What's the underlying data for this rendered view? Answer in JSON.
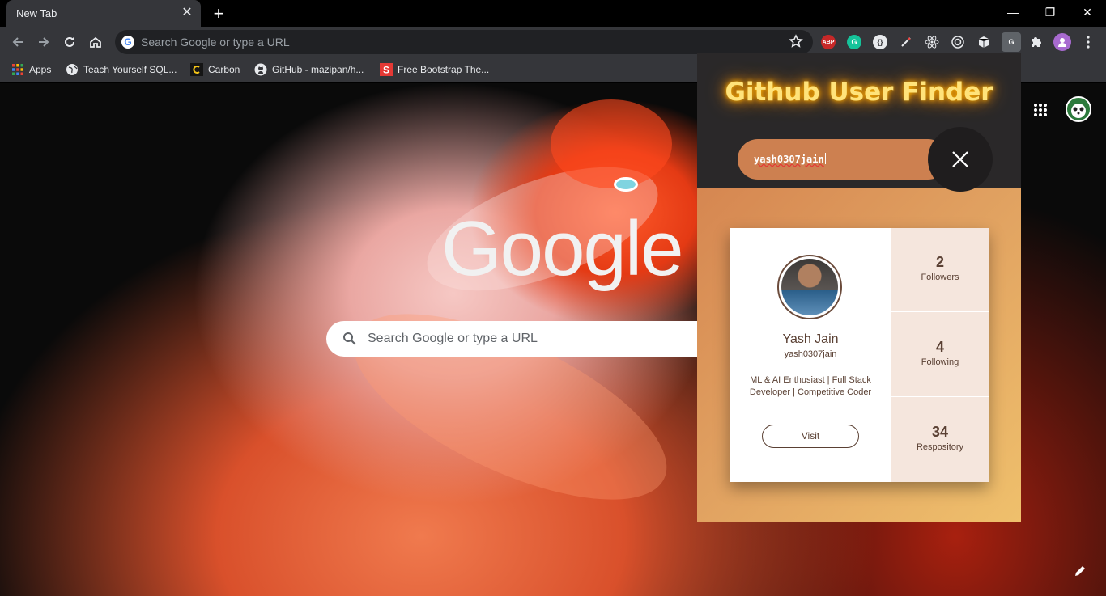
{
  "browser": {
    "tab_title": "New Tab",
    "tab_close": "✕",
    "new_tab": "+",
    "window_controls": {
      "minimize": "—",
      "restore": "❐",
      "close": "✕"
    },
    "omnibox_placeholder": "Search Google or type a URL",
    "omnibox_icon": "G",
    "extensions": [
      "ABP",
      "G",
      "",
      "",
      "",
      "",
      "",
      "G",
      "",
      ""
    ]
  },
  "bookmarks": [
    {
      "label": "Apps",
      "icon": "apps-grid-icon"
    },
    {
      "label": "Teach Yourself SQL...",
      "icon": "globe-icon"
    },
    {
      "label": "Carbon",
      "icon": "carbon-icon"
    },
    {
      "label": "GitHub - mazipan/h...",
      "icon": "github-icon"
    },
    {
      "label": "Free Bootstrap The...",
      "icon": "s-icon"
    }
  ],
  "ntp": {
    "logo": "Google",
    "search_placeholder": "Search Google or type a URL"
  },
  "popup": {
    "title": "Github User Finder",
    "search_value": "yash0307jain",
    "user": {
      "name": "Yash Jain",
      "login": "yash0307jain",
      "bio": "ML & AI Enthusiast | Full Stack Developer | Competitive Coder",
      "visit_label": "Visit"
    },
    "stats": [
      {
        "value": "2",
        "label": "Followers"
      },
      {
        "value": "4",
        "label": "Following"
      },
      {
        "value": "34",
        "label": "Respository"
      }
    ]
  },
  "colors": {
    "popup_header": "#2a2829",
    "title_glow": "#ffb300",
    "accent_orange": "#cd8050",
    "card_text": "#5a4033"
  }
}
